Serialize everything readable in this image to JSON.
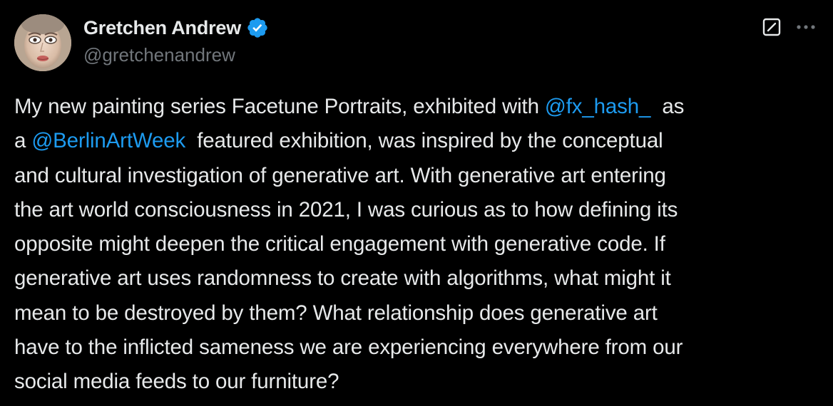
{
  "author": {
    "display_name": "Gretchen Andrew",
    "handle": "@gretchenandrew",
    "verified": true,
    "avatar_icon": "profile-photo-icon"
  },
  "header_actions": {
    "grok_icon": "grok-icon",
    "more_icon": "more-horizontal-icon"
  },
  "colors": {
    "background": "#000000",
    "text": "#e7e9ea",
    "secondary_text": "#71767b",
    "link": "#1d9bf0",
    "verified_badge": "#1d9bf0"
  },
  "tweet": {
    "lines": [
      {
        "segments": [
          {
            "text": "My new painting series Facetune Portraits, exhibited with "
          },
          {
            "text": "@fx_hash_",
            "mention": true
          },
          {
            "text": "  as"
          }
        ]
      },
      {
        "segments": [
          {
            "text": "a "
          },
          {
            "text": "@BerlinArtWeek",
            "mention": true
          },
          {
            "text": "  featured exhibition, was inspired by the conceptual"
          }
        ]
      },
      {
        "segments": [
          {
            "text": "and cultural investigation of generative art. With generative art entering"
          }
        ]
      },
      {
        "segments": [
          {
            "text": "the art world consciousness in 2021, I was curious as to how defining its"
          }
        ]
      },
      {
        "segments": [
          {
            "text": "opposite might deepen the critical engagement with generative code. If"
          }
        ]
      },
      {
        "segments": [
          {
            "text": "generative art uses randomness to create with algorithms, what might it"
          }
        ]
      },
      {
        "segments": [
          {
            "text": "mean to be destroyed by them? What relationship does generative art"
          }
        ]
      },
      {
        "segments": [
          {
            "text": "have to the inflicted sameness we are experiencing everywhere from our"
          }
        ]
      },
      {
        "segments": [
          {
            "text": "social media feeds to our furniture?"
          }
        ]
      }
    ]
  }
}
